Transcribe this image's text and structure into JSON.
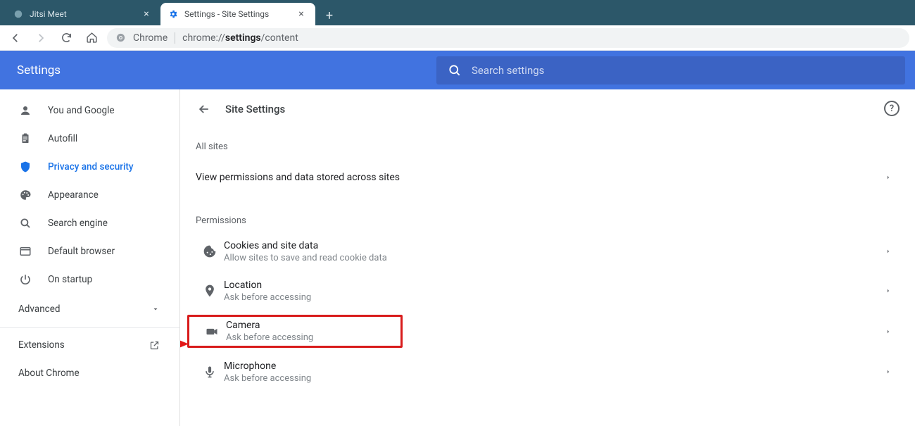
{
  "tabs": [
    {
      "title": "Jitsi Meet",
      "active": false
    },
    {
      "title": "Settings - Site Settings",
      "active": true
    }
  ],
  "omnibox": {
    "chip": "Chrome",
    "url_prefix": "chrome://",
    "url_bold": "settings",
    "url_suffix": "/content"
  },
  "header": {
    "title": "Settings",
    "search_placeholder": "Search settings"
  },
  "sidebar": {
    "items": [
      {
        "icon": "person-icon",
        "label": "You and Google"
      },
      {
        "icon": "clipboard-icon",
        "label": "Autofill"
      },
      {
        "icon": "shield-icon",
        "label": "Privacy and security",
        "selected": true
      },
      {
        "icon": "palette-icon",
        "label": "Appearance"
      },
      {
        "icon": "search-icon",
        "label": "Search engine"
      },
      {
        "icon": "browser-icon",
        "label": "Default browser"
      },
      {
        "icon": "power-icon",
        "label": "On startup"
      }
    ],
    "advanced_label": "Advanced",
    "extensions_label": "Extensions",
    "about_label": "About Chrome"
  },
  "content": {
    "page_title": "Site Settings",
    "all_sites_label": "All sites",
    "view_permissions_label": "View permissions and data stored across sites",
    "permissions_label": "Permissions",
    "rows": [
      {
        "icon": "cookie-icon",
        "title": "Cookies and site data",
        "sub": "Allow sites to save and read cookie data"
      },
      {
        "icon": "location-icon",
        "title": "Location",
        "sub": "Ask before accessing"
      },
      {
        "icon": "camera-icon",
        "title": "Camera",
        "sub": "Ask before accessing",
        "highlight": true
      },
      {
        "icon": "mic-icon",
        "title": "Microphone",
        "sub": "Ask before accessing"
      }
    ]
  }
}
